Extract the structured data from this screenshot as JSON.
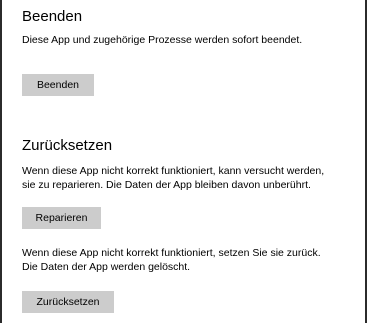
{
  "terminate": {
    "heading": "Beenden",
    "description": "Diese App und zugehörige Prozesse werden sofort beendet.",
    "button_label": "Beenden"
  },
  "reset": {
    "heading": "Zurücksetzen",
    "repair_description_line1": "Wenn diese App nicht korrekt funktioniert, kann versucht werden,",
    "repair_description_line2": "sie zu reparieren. Die Daten der App bleiben davon unberührt.",
    "repair_button_label": "Reparieren",
    "reset_description_line1": "Wenn diese App nicht korrekt funktioniert, setzen Sie sie zurück.",
    "reset_description_line2": "Die Daten der App werden gelöscht.",
    "reset_button_label": "Zurücksetzen"
  },
  "colors": {
    "button_background": "#cccccc",
    "panel_border": "#2b2b2b",
    "text": "#000000"
  }
}
